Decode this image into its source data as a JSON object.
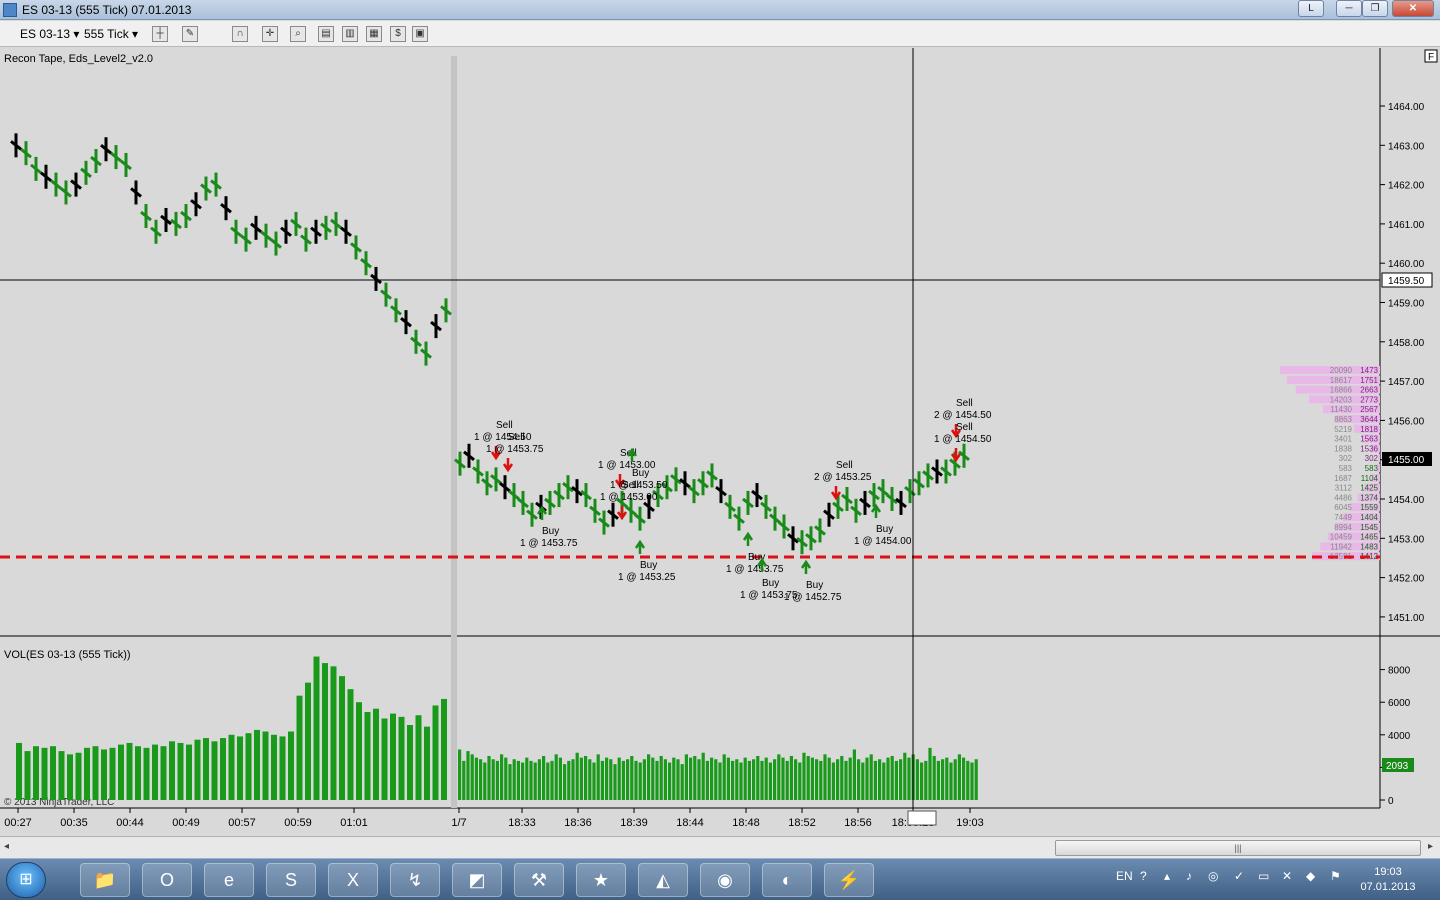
{
  "window": {
    "title": "ES 03-13 (555 Tick)  07.01.2013",
    "lang_indicator": "L"
  },
  "toolbar": {
    "instrument": "ES 03-13",
    "interval": "555 Tick"
  },
  "chart": {
    "indicator_label": "Recon Tape, Eds_Level2_v2.0",
    "volume_label": "VOL(ES 03-13 (555 Tick))",
    "copyright": "© 2013 NinjaTrader, LLC",
    "price_axis": [
      "1464.00",
      "1463.00",
      "1462.00",
      "1461.00",
      "1460.00",
      "1459.00",
      "1458.00",
      "1457.00",
      "1456.00",
      "1455.00",
      "1454.00",
      "1453.00",
      "1452.00",
      "1451.00"
    ],
    "crosshair_price": "1459.50",
    "last_price": "1455.00",
    "volume_axis": [
      "8000",
      "6000",
      "4000",
      "2000",
      "0"
    ],
    "last_volume": "2093",
    "time_axis": [
      "00:27",
      "00:35",
      "00:44",
      "00:49",
      "00:57",
      "00:59",
      "01:01",
      "1/7",
      "18:33",
      "18:36",
      "18:39",
      "18:44",
      "18:48",
      "18:52",
      "18:56",
      "18:59:28",
      "19:03"
    ],
    "depth": [
      {
        "bid": "20090",
        "ask": "1473"
      },
      {
        "bid": "18617",
        "ask": "1751"
      },
      {
        "bid": "16866",
        "ask": "2663"
      },
      {
        "bid": "14203",
        "ask": "2773"
      },
      {
        "bid": "11430",
        "ask": "2567"
      },
      {
        "bid": "8863",
        "ask": "3644"
      },
      {
        "bid": "5219",
        "ask": "1818"
      },
      {
        "bid": "3401",
        "ask": "1563"
      },
      {
        "bid": "1838",
        "ask": "1536"
      },
      {
        "bid": "302",
        "ask": "302"
      },
      {
        "bid": "583",
        "ask": "583"
      },
      {
        "bid": "1687",
        "ask": "1104"
      },
      {
        "bid": "3112",
        "ask": "1425"
      },
      {
        "bid": "4486",
        "ask": "1374"
      },
      {
        "bid": "6045",
        "ask": "1559"
      },
      {
        "bid": "7449",
        "ask": "1404"
      },
      {
        "bid": "8994",
        "ask": "1545"
      },
      {
        "bid": "10459",
        "ask": "1465"
      },
      {
        "bid": "11942",
        "ask": "1483"
      },
      {
        "bid": "13591",
        "ask": "1412"
      }
    ],
    "trade_labels": [
      {
        "side": "Sell",
        "qty_price": "1 @ 1454.50"
      },
      {
        "side": "Sell",
        "qty_price": "1 @ 1453.75"
      },
      {
        "side": "Sell",
        "qty_price": "1 @ 1453.00"
      },
      {
        "side": "Buy",
        "qty_price": "1 @ 1453.50"
      },
      {
        "side": "Sell",
        "qty_price": "1 @ 1453.00"
      },
      {
        "side": "Sell",
        "qty_price": "2 @ 1453.25"
      },
      {
        "side": "Sell",
        "qty_price": "2 @ 1454.50"
      },
      {
        "side": "Sell",
        "qty_price": "1 @ 1454.50"
      },
      {
        "side": "Buy",
        "qty_price": "1 @ 1453.75"
      },
      {
        "side": "Buy",
        "qty_price": "1 @ 1453.75"
      },
      {
        "side": "Buy",
        "qty_price": "1 @ 1453.25"
      },
      {
        "side": "Buy",
        "qty_price": "1 @ 1453.75"
      },
      {
        "side": "Buy",
        "qty_price": "1 @ 1452.75"
      },
      {
        "side": "Buy",
        "qty_price": "1 @ 1454.00"
      }
    ],
    "colors": {
      "up_bar": "#1a8a1a",
      "down_bar": "#000000",
      "volume_bar": "#1a9a1a",
      "bid_depth": "#e8b8e8",
      "ask_depth": "#b8e8b8",
      "support_line": "#dd1111",
      "buy_arrow": "#1a8a1a",
      "sell_arrow": "#dd1111"
    }
  },
  "taskbar": {
    "lang": "EN",
    "time": "19:03",
    "date": "07.01.2013",
    "apps": [
      "folder-icon",
      "opera-icon",
      "ie-icon",
      "skype-icon",
      "x-icon",
      "ninjatrader-icon",
      "office-icon",
      "tool-icon",
      "star-icon",
      "wolf-icon",
      "tank-icon",
      "media-icon",
      "torch-icon"
    ]
  }
}
